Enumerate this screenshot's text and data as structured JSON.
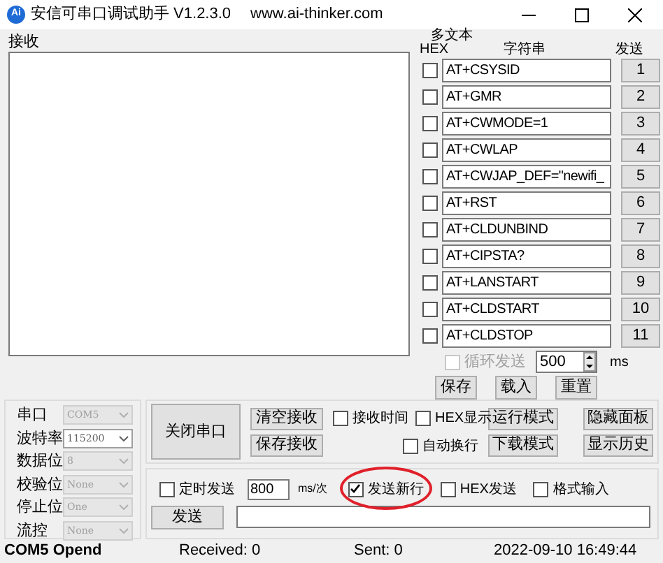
{
  "window": {
    "title": "安信可串口调试助手 V1.2.3.0",
    "url": "www.ai-thinker.com",
    "logo": "Ai"
  },
  "receive": {
    "label": "接收"
  },
  "multi_text": {
    "title": "多文本",
    "headers": [
      "HEX",
      "字符串",
      "发送"
    ],
    "rows": [
      {
        "hex": false,
        "text": "AT+CSYSID",
        "button": "1"
      },
      {
        "hex": false,
        "text": "AT+GMR",
        "button": "2"
      },
      {
        "hex": false,
        "text": "AT+CWMODE=1",
        "button": "3"
      },
      {
        "hex": false,
        "text": "AT+CWLAP",
        "button": "4"
      },
      {
        "hex": false,
        "text": "AT+CWJAP_DEF=\"newifi_",
        "button": "5"
      },
      {
        "hex": false,
        "text": "AT+RST",
        "button": "6"
      },
      {
        "hex": false,
        "text": "AT+CLDUNBIND",
        "button": "7"
      },
      {
        "hex": false,
        "text": "AT+CIPSTA?",
        "button": "8"
      },
      {
        "hex": false,
        "text": "AT+LANSTART",
        "button": "9"
      },
      {
        "hex": false,
        "text": "AT+CLDSTART",
        "button": "10"
      },
      {
        "hex": false,
        "text": "AT+CLDSTOP",
        "button": "11"
      }
    ],
    "loop": {
      "label": "循环发送",
      "checked": false,
      "disabled": true,
      "value": "500",
      "unit": "ms"
    },
    "buttons": [
      "保存",
      "载入",
      "重置"
    ]
  },
  "serial": [
    {
      "label": "串口",
      "value": "COM5",
      "disabled": true
    },
    {
      "label": "波特率",
      "value": "115200",
      "disabled": false
    },
    {
      "label": "数据位",
      "value": "8",
      "disabled": true
    },
    {
      "label": "校验位",
      "value": "None",
      "disabled": true
    },
    {
      "label": "停止位",
      "value": "One",
      "disabled": true
    },
    {
      "label": "流控",
      "value": "None",
      "disabled": true
    }
  ],
  "open_button": "关闭串口",
  "receive_buttons": [
    "清空接收",
    "保存接收"
  ],
  "receive_options": [
    {
      "label": "接收时间",
      "checked": false
    },
    {
      "label": "HEX显示",
      "checked": false
    },
    {
      "label": "自动换行",
      "checked": false
    }
  ],
  "mode_buttons": [
    "运行模式",
    "下载模式"
  ],
  "panel_buttons": [
    "隐藏面板",
    "显示历史"
  ],
  "send": {
    "timed": {
      "label": "定时发送",
      "checked": false
    },
    "interval": "800",
    "unit": "ms/次",
    "options": [
      {
        "label": "发送新行",
        "checked": true,
        "circled": true
      },
      {
        "label": "HEX发送",
        "checked": false,
        "circled": false
      },
      {
        "label": "格式输入",
        "checked": false,
        "circled": false
      }
    ],
    "button": "发送"
  },
  "status_bar": {
    "port": "COM5 Opend",
    "received": "Received: 0",
    "sent": "Sent: 0",
    "time": "2022-09-10 16:49:44"
  }
}
